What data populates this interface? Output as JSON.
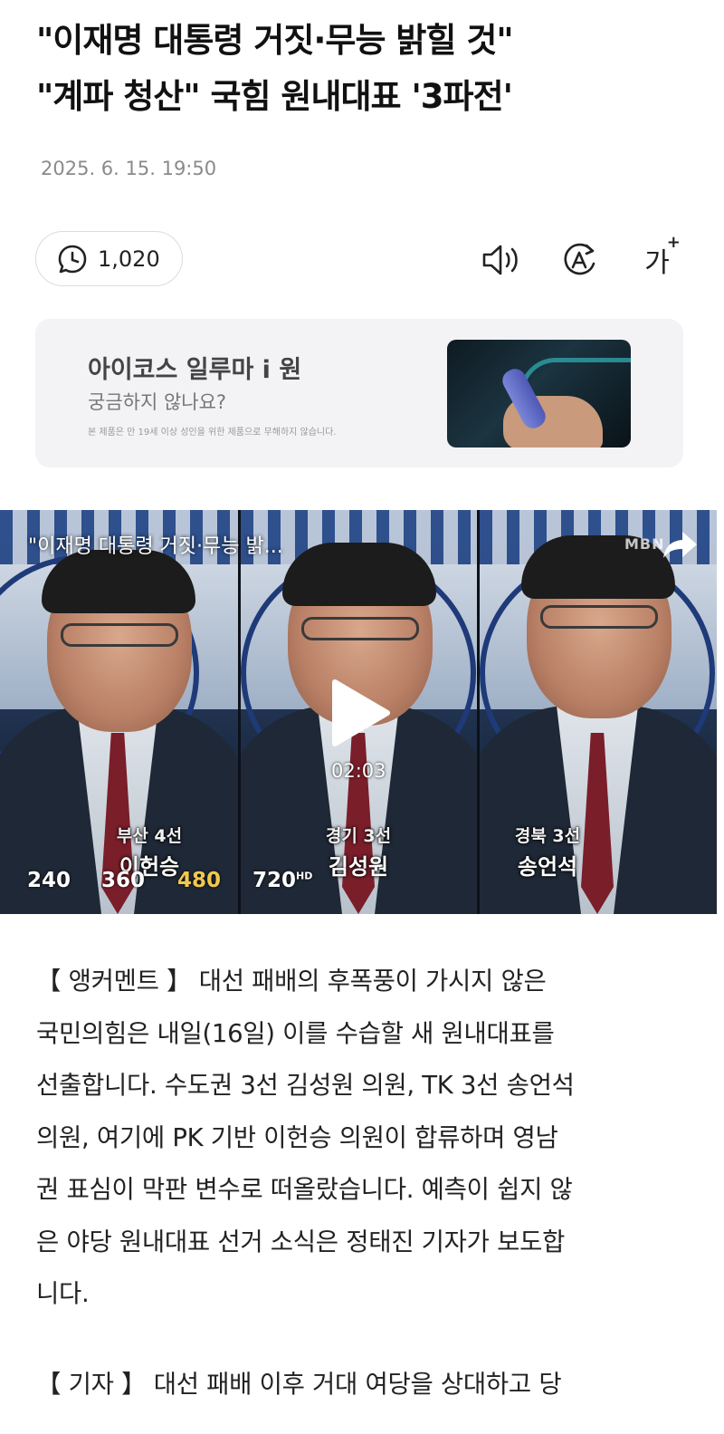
{
  "article": {
    "headline_line1": "\"이재명 대통령 거짓·무능 밝힐 것\"",
    "headline_line2": "\"계파 청산\" 국힘 원내대표 '3파전'",
    "date": "2025. 6. 15. 19:50"
  },
  "toolbar": {
    "comment_count": "1,020",
    "audio_icon": "speaker-icon",
    "translate_icon": "translate-icon",
    "font_label": "가",
    "font_plus": "+"
  },
  "ad": {
    "title": "아이코스 일루마 i 원",
    "subtitle": "궁금하지 않나요?",
    "notice": "본 제품은 만 19세 이상 성인을 위한 제품으로 무해하지 않습니다."
  },
  "video": {
    "title": "\"이재명 대통령 거짓·무능 밝...",
    "brand": "MBN",
    "duration": "02:03",
    "people": [
      {
        "region": "부산 4선",
        "name": "이헌승"
      },
      {
        "region": "경기 3선",
        "name": "김성원"
      },
      {
        "region": "경북 3선",
        "name": "송언석"
      }
    ],
    "qualities": [
      "240",
      "360",
      "480",
      "720"
    ],
    "quality_hd_badge": "HD",
    "selected_quality": "480"
  },
  "body": {
    "p1_lines": [
      "【 앵커멘트 】  대선 패배의 후폭풍이 가시지 않은",
      "국민의힘은 내일(16일) 이를 수습할 새 원내대표를",
      "선출합니다. 수도권 3선 김성원 의원, TK 3선 송언석",
      "의원, 여기에 PK 기반 이헌승 의원이 합류하며 영남",
      "권 표심이 막판 변수로 떠올랐습니다. 예측이 쉽지 않",
      "은 야당 원내대표 선거 소식은 정태진 기자가 보도합",
      "니다."
    ],
    "p2_line1": "【 기자 】  대선 패배 이후 거대 여당을 상대하고 당"
  }
}
